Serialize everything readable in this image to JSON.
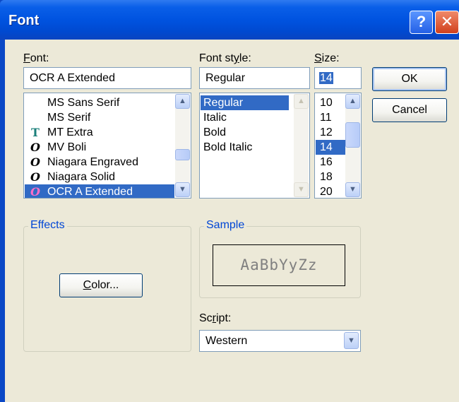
{
  "window": {
    "title": "Font",
    "help_glyph": "?",
    "close_glyph": "✕"
  },
  "labels": {
    "font_prefix": "F",
    "font_rest": "ont:",
    "style_prefix": "Font st",
    "style_u": "y",
    "style_rest": "le:",
    "size_prefix": "S",
    "size_rest": "ize:",
    "script_prefix": "Sc",
    "script_u": "r",
    "script_rest": "ipt:"
  },
  "font": {
    "value": "OCR A Extended",
    "items": [
      {
        "label": "MS Sans Serif",
        "icon": "",
        "selected": false
      },
      {
        "label": "MS Serif",
        "icon": "",
        "selected": false
      },
      {
        "label": "MT Extra",
        "icon": "truetype-icon",
        "selected": false
      },
      {
        "label": "MV Boli",
        "icon": "opentype-icon",
        "selected": false
      },
      {
        "label": "Niagara Engraved",
        "icon": "opentype-icon",
        "selected": false
      },
      {
        "label": "Niagara Solid",
        "icon": "opentype-icon",
        "selected": false
      },
      {
        "label": "OCR A Extended",
        "icon": "opentype-icon",
        "selected": true
      }
    ]
  },
  "style": {
    "value": "Regular",
    "items": [
      {
        "label": "Regular",
        "selected": true
      },
      {
        "label": "Italic",
        "selected": false
      },
      {
        "label": "Bold",
        "selected": false
      },
      {
        "label": "Bold Italic",
        "selected": false
      }
    ]
  },
  "size": {
    "value": "14",
    "items": [
      {
        "label": "10",
        "selected": false
      },
      {
        "label": "11",
        "selected": false
      },
      {
        "label": "12",
        "selected": false
      },
      {
        "label": "14",
        "selected": true
      },
      {
        "label": "16",
        "selected": false
      },
      {
        "label": "18",
        "selected": false
      },
      {
        "label": "20",
        "selected": false
      }
    ]
  },
  "buttons": {
    "ok": "OK",
    "cancel": "Cancel",
    "color_u": "C",
    "color_rest": "olor..."
  },
  "effects": {
    "legend": "Effects"
  },
  "sample": {
    "legend": "Sample",
    "text": "AaBbYyZz"
  },
  "script": {
    "value": "Western"
  },
  "colors": {
    "titlebar": "#0053e0",
    "selection": "#316ac5",
    "group_legend": "#0046d5",
    "dialog_bg": "#ece9d8"
  }
}
